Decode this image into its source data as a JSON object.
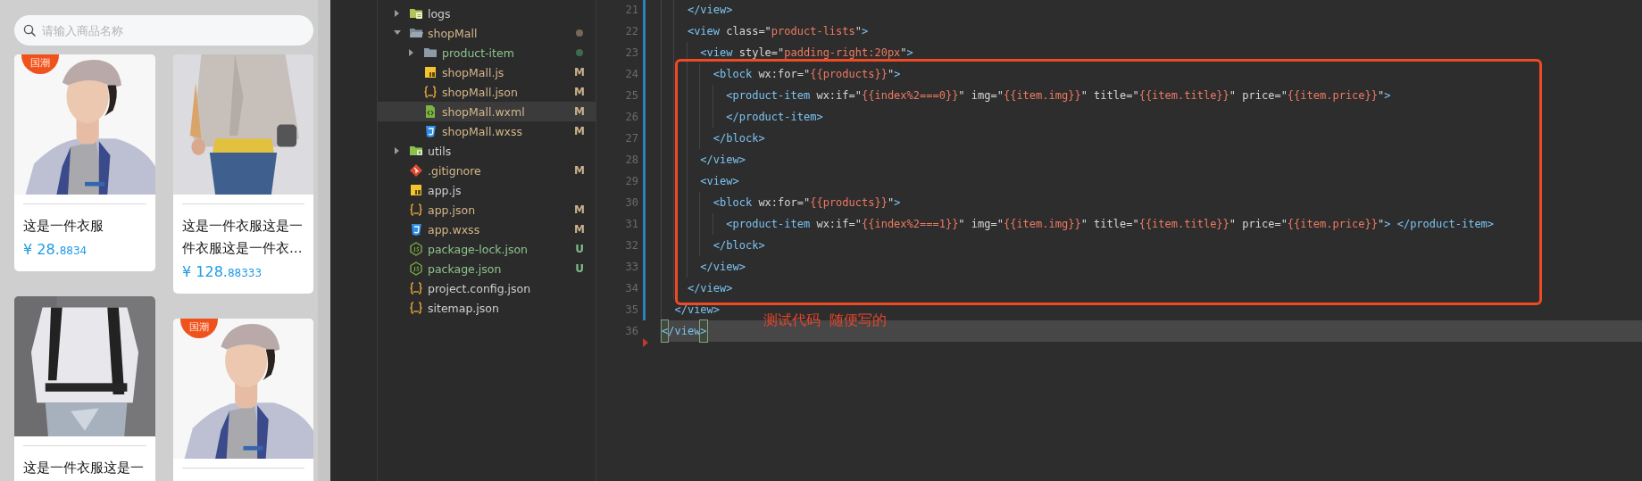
{
  "phone": {
    "search": {
      "placeholder": "请输入商品名称"
    },
    "columns": [
      [
        {
          "kind": "picture",
          "badge": "国潮",
          "title": "这是一件衣服",
          "price": "¥ 28.",
          "price_decimals": "8834"
        },
        {
          "kind": "picture",
          "title": "这是一件衣服这是一"
        }
      ],
      [
        {
          "kind": "picture",
          "title": "这是一件衣服这是一件衣服这是一件衣…",
          "price": "¥ 128.",
          "price_decimals": "88333"
        },
        {
          "kind": "picture",
          "badge": "国潮"
        }
      ]
    ]
  },
  "file_tree": [
    {
      "name": "logs",
      "kind": "logs",
      "expanded": false,
      "selected": false,
      "modified": false,
      "untracked": false
    },
    {
      "name": "shopMall",
      "kind": "folder",
      "expanded": true,
      "selected": false,
      "modified": true,
      "untracked": false,
      "color": "#756858",
      "children": [
        {
          "name": "product-item",
          "kind": "folder",
          "expanded": false,
          "selected": false,
          "modified": false,
          "untracked": true,
          "color": "#3f6b4c"
        },
        {
          "name": "shopMall.js",
          "kind": "js",
          "selected": false,
          "modified": true,
          "untracked": false,
          "badge": "M"
        },
        {
          "name": "shopMall.json",
          "kind": "json",
          "selected": false,
          "modified": true,
          "untracked": false,
          "badge": "M"
        },
        {
          "name": "shopMall.wxml",
          "kind": "wxml",
          "selected": true,
          "modified": true,
          "untracked": false,
          "badge": "M"
        },
        {
          "name": "shopMall.wxss",
          "kind": "wxss",
          "selected": false,
          "modified": true,
          "untracked": false,
          "badge": "M"
        }
      ]
    },
    {
      "name": "utils",
      "kind": "utils",
      "expanded": false,
      "selected": false,
      "modified": false,
      "untracked": false
    },
    {
      "name": ".gitignore",
      "kind": "git",
      "selected": false,
      "modified": true,
      "untracked": false,
      "badge": "M"
    },
    {
      "name": "app.js",
      "kind": "js",
      "selected": false,
      "modified": false,
      "untracked": false
    },
    {
      "name": "app.json",
      "kind": "json",
      "selected": false,
      "modified": true,
      "untracked": false,
      "badge": "M"
    },
    {
      "name": "app.wxss",
      "kind": "wxss",
      "selected": false,
      "modified": true,
      "untracked": false,
      "badge": "M"
    },
    {
      "name": "package-lock.json",
      "kind": "node",
      "selected": false,
      "modified": false,
      "untracked": true,
      "badge": "U"
    },
    {
      "name": "package.json",
      "kind": "node",
      "selected": false,
      "modified": false,
      "untracked": true,
      "badge": "U"
    },
    {
      "name": "project.config.json",
      "kind": "json",
      "selected": false,
      "modified": false,
      "untracked": false
    },
    {
      "name": "sitemap.json",
      "kind": "json",
      "selected": false,
      "modified": false,
      "untracked": false
    }
  ],
  "editor": {
    "lines": [
      {
        "number": "21",
        "changed": true,
        "current": false,
        "tokens": [
          {
            "kind": "tag",
            "text": "    </view>"
          }
        ]
      },
      {
        "number": "22",
        "changed": true,
        "current": false,
        "tokens": [
          {
            "kind": "tag",
            "text": "    <view"
          },
          {
            "kind": "attr",
            "text": " class=\""
          },
          {
            "kind": "string",
            "text": "product-lists"
          },
          {
            "kind": "attr",
            "text": "\""
          },
          {
            "kind": "tag",
            "text": ">"
          }
        ]
      },
      {
        "number": "23",
        "changed": true,
        "current": false,
        "tokens": [
          {
            "kind": "tag",
            "text": "      <view"
          },
          {
            "kind": "attr",
            "text": " style=\""
          },
          {
            "kind": "string",
            "text": "padding-right:20px"
          },
          {
            "kind": "attr",
            "text": "\""
          },
          {
            "kind": "tag",
            "text": ">"
          }
        ]
      },
      {
        "number": "24",
        "changed": true,
        "current": false,
        "tokens": [
          {
            "kind": "tag",
            "text": "        <block"
          },
          {
            "kind": "attr",
            "text": " wx:for=\""
          },
          {
            "kind": "string",
            "text": "{{products}}"
          },
          {
            "kind": "attr",
            "text": "\""
          },
          {
            "kind": "tag",
            "text": ">"
          }
        ]
      },
      {
        "number": "25",
        "changed": true,
        "current": false,
        "tokens": [
          {
            "kind": "tag",
            "text": "          <product-item"
          },
          {
            "kind": "attr",
            "text": " wx:if=\""
          },
          {
            "kind": "string",
            "text": "{{index%2===0}}"
          },
          {
            "kind": "attr",
            "text": "\" img=\""
          },
          {
            "kind": "string",
            "text": "{{item.img}}"
          },
          {
            "kind": "attr",
            "text": "\" title=\""
          },
          {
            "kind": "string",
            "text": "{{item.title}}"
          },
          {
            "kind": "attr",
            "text": "\" price=\""
          },
          {
            "kind": "string",
            "text": "{{item.price}}"
          },
          {
            "kind": "attr",
            "text": "\""
          },
          {
            "kind": "tag",
            "text": ">"
          }
        ]
      },
      {
        "number": "26",
        "changed": true,
        "current": false,
        "tokens": [
          {
            "kind": "tag",
            "text": "          </product-item>"
          }
        ]
      },
      {
        "number": "27",
        "changed": true,
        "current": false,
        "tokens": [
          {
            "kind": "tag",
            "text": "        </block>"
          }
        ]
      },
      {
        "number": "28",
        "changed": true,
        "current": false,
        "tokens": [
          {
            "kind": "tag",
            "text": "      </view>"
          }
        ]
      },
      {
        "number": "29",
        "changed": true,
        "current": false,
        "tokens": [
          {
            "kind": "tag",
            "text": "      <view>"
          }
        ]
      },
      {
        "number": "30",
        "changed": true,
        "current": false,
        "tokens": [
          {
            "kind": "tag",
            "text": "        <block"
          },
          {
            "kind": "attr",
            "text": " wx:for=\""
          },
          {
            "kind": "string",
            "text": "{{products}}"
          },
          {
            "kind": "attr",
            "text": "\""
          },
          {
            "kind": "tag",
            "text": ">"
          }
        ]
      },
      {
        "number": "31",
        "changed": true,
        "current": false,
        "tokens": [
          {
            "kind": "tag",
            "text": "          <product-item"
          },
          {
            "kind": "attr",
            "text": " wx:if=\""
          },
          {
            "kind": "string",
            "text": "{{index%2===1}}"
          },
          {
            "kind": "attr",
            "text": "\" img=\""
          },
          {
            "kind": "string",
            "text": "{{item.img}}"
          },
          {
            "kind": "attr",
            "text": "\" title=\""
          },
          {
            "kind": "string",
            "text": "{{item.title}}"
          },
          {
            "kind": "attr",
            "text": "\" price=\""
          },
          {
            "kind": "string",
            "text": "{{item.price}}"
          },
          {
            "kind": "attr",
            "text": "\""
          },
          {
            "kind": "tag",
            "text": "> </product-item>"
          }
        ]
      },
      {
        "number": "32",
        "changed": true,
        "current": false,
        "tokens": [
          {
            "kind": "tag",
            "text": "        </block>"
          }
        ]
      },
      {
        "number": "33",
        "changed": true,
        "current": false,
        "tokens": [
          {
            "kind": "tag",
            "text": "      </view>"
          }
        ]
      },
      {
        "number": "34",
        "changed": true,
        "current": false,
        "tokens": [
          {
            "kind": "tag",
            "text": "    </view>"
          }
        ]
      },
      {
        "number": "35",
        "changed": true,
        "current": false,
        "tokens": [
          {
            "kind": "tag",
            "text": "  </view>"
          }
        ]
      },
      {
        "number": "36",
        "changed": false,
        "current": true,
        "deleted_below": true,
        "tokens": [
          {
            "kind": "bracket",
            "text": "<"
          },
          {
            "kind": "tag",
            "text": "/view"
          },
          {
            "kind": "bracket",
            "text": ">"
          }
        ]
      }
    ],
    "annotation": {
      "text": "测试代码  随便写的"
    }
  }
}
